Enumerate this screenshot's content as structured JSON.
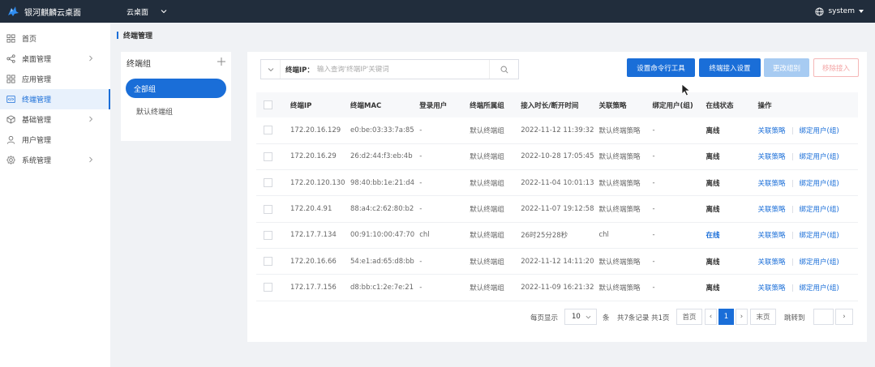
{
  "app": {
    "title": "银河麒麟云桌面"
  },
  "header": {
    "desktop_selector": "云桌面",
    "user": "system"
  },
  "sidebar": {
    "items": [
      {
        "label": "首页",
        "icon": "grid-icon",
        "has_arrow": false
      },
      {
        "label": "桌面管理",
        "icon": "share-icon",
        "has_arrow": true
      },
      {
        "label": "应用管理",
        "icon": "apps-icon",
        "has_arrow": false
      },
      {
        "label": "终端管理",
        "icon": "code-icon",
        "has_arrow": false,
        "active": true
      },
      {
        "label": "基础管理",
        "icon": "cube-icon",
        "has_arrow": true
      },
      {
        "label": "用户管理",
        "icon": "user-icon",
        "has_arrow": false
      },
      {
        "label": "系统管理",
        "icon": "gear-icon",
        "has_arrow": true
      }
    ]
  },
  "page": {
    "title": "终端管理"
  },
  "groups": {
    "title": "终端组",
    "all_label": "全部组",
    "default_label": "默认终端组"
  },
  "search": {
    "label": "终端IP：",
    "placeholder": "输入查询'终端IP'关键词"
  },
  "toolbar": {
    "set_cmd_tool": "设置命令行工具",
    "access_settings": "终端接入设置",
    "change_group": "更改组别",
    "remove_access": "移除接入"
  },
  "table": {
    "columns": [
      "终端IP",
      "终端MAC",
      "登录用户",
      "终端所属组",
      "接入时长/断开时间",
      "关联策略",
      "绑定用户(组)",
      "在线状态",
      "操作"
    ],
    "rows": [
      {
        "ip": "172.20.16.129",
        "mac": "e0:be:03:33:7a:85",
        "user": "-",
        "group": "默认终端组",
        "time": "2022-11-12 11:39:32",
        "policy": "默认终端策略",
        "bind": "-",
        "status": "离线",
        "online": false
      },
      {
        "ip": "172.20.16.29",
        "mac": "26:d2:44:f3:eb:4b",
        "user": "-",
        "group": "默认终端组",
        "time": "2022-10-28 17:05:45",
        "policy": "默认终端策略",
        "bind": "-",
        "status": "离线",
        "online": false
      },
      {
        "ip": "172.20.120.130",
        "mac": "98:40:bb:1e:21:d4",
        "user": "-",
        "group": "默认终端组",
        "time": "2022-11-04 10:01:13",
        "policy": "默认终端策略",
        "bind": "-",
        "status": "离线",
        "online": false
      },
      {
        "ip": "172.20.4.91",
        "mac": "88:a4:c2:62:80:b2",
        "user": "-",
        "group": "默认终端组",
        "time": "2022-11-07 19:12:58",
        "policy": "默认终端策略",
        "bind": "-",
        "status": "离线",
        "online": false
      },
      {
        "ip": "172.17.7.134",
        "mac": "00:91:10:00:47:70",
        "user": "chl",
        "group": "默认终端组",
        "time": "26时25分28秒",
        "policy": "chl",
        "bind": "-",
        "status": "在线",
        "online": true
      },
      {
        "ip": "172.20.16.66",
        "mac": "54:e1:ad:65:d8:bb",
        "user": "-",
        "group": "默认终端组",
        "time": "2022-11-12 14:11:20",
        "policy": "默认终端策略",
        "bind": "-",
        "status": "离线",
        "online": false
      },
      {
        "ip": "172.17.7.156",
        "mac": "d8:bb:c1:2e:7e:21",
        "user": "-",
        "group": "默认终端组",
        "time": "2022-11-09 16:21:32",
        "policy": "默认终端策略",
        "bind": "-",
        "status": "离线",
        "online": false
      }
    ],
    "action_policy": "关联策略",
    "action_bind": "绑定用户(组)"
  },
  "pagination": {
    "per_page_label": "每页显示",
    "per_page": "10",
    "unit": "条",
    "total_text": "共7条记录 共1页",
    "first": "首页",
    "prev": "‹",
    "current": "1",
    "next": "›",
    "last": "末页",
    "jump_label": "跳转到",
    "go": "›"
  },
  "colors": {
    "primary": "#1a6ed8",
    "topbar": "#212d3c",
    "disabled": "#a7cbf2",
    "danger_text": "#f3a3a3"
  }
}
